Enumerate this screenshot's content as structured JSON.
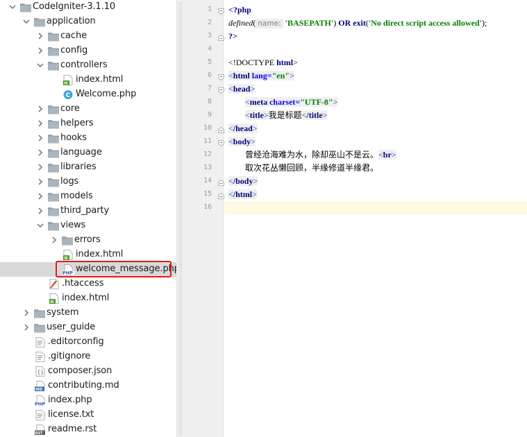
{
  "tree": {
    "items": [
      {
        "label": "CodeIgniter-3.1.10",
        "type": "folder",
        "state": "expanded"
      },
      {
        "label": "application",
        "type": "folder",
        "state": "expanded"
      },
      {
        "label": "cache",
        "type": "folder",
        "state": "collapsed"
      },
      {
        "label": "config",
        "type": "folder",
        "state": "collapsed"
      },
      {
        "label": "controllers",
        "type": "folder",
        "state": "expanded"
      },
      {
        "label": "index.html",
        "type": "html-file"
      },
      {
        "label": "Welcome.php",
        "type": "php-class-file"
      },
      {
        "label": "core",
        "type": "folder",
        "state": "collapsed"
      },
      {
        "label": "helpers",
        "type": "folder",
        "state": "collapsed"
      },
      {
        "label": "hooks",
        "type": "folder",
        "state": "collapsed"
      },
      {
        "label": "language",
        "type": "folder",
        "state": "collapsed"
      },
      {
        "label": "libraries",
        "type": "folder",
        "state": "collapsed"
      },
      {
        "label": "logs",
        "type": "folder",
        "state": "collapsed"
      },
      {
        "label": "models",
        "type": "folder",
        "state": "collapsed"
      },
      {
        "label": "third_party",
        "type": "folder",
        "state": "collapsed"
      },
      {
        "label": "views",
        "type": "folder",
        "state": "expanded"
      },
      {
        "label": "errors",
        "type": "folder",
        "state": "collapsed"
      },
      {
        "label": "index.html",
        "type": "html-file"
      },
      {
        "label": "welcome_message.php",
        "type": "php-file",
        "selected": true
      },
      {
        "label": ".htaccess",
        "type": "htaccess-file"
      },
      {
        "label": "index.html",
        "type": "html-file"
      },
      {
        "label": "system",
        "type": "folder",
        "state": "collapsed"
      },
      {
        "label": "user_guide",
        "type": "folder",
        "state": "collapsed"
      },
      {
        "label": ".editorconfig",
        "type": "text-file"
      },
      {
        "label": ".gitignore",
        "type": "text-file"
      },
      {
        "label": "composer.json",
        "type": "json-file"
      },
      {
        "label": "contributing.md",
        "type": "md-file"
      },
      {
        "label": "index.php",
        "type": "php-file"
      },
      {
        "label": "license.txt",
        "type": "text-file"
      },
      {
        "label": "readme.rst",
        "type": "rst-file"
      }
    ],
    "highlight_color": "#e21b1b"
  },
  "icons": {
    "php": "PHP",
    "html": "H",
    "md": "MD",
    "rst": "RST",
    "class": "C"
  },
  "editor": {
    "line_numbers": [
      "1",
      "2",
      "3",
      "4",
      "5",
      "6",
      "7",
      "8",
      "9",
      "10",
      "11",
      "12",
      "13",
      "14",
      "15",
      "16"
    ],
    "code": {
      "l1_open": "<?php",
      "l2_fn": "defined",
      "l2_paren_open": "(",
      "l2_hint": "name:",
      "l2_str1": "'BASEPATH'",
      "l2_mid": ") ",
      "l2_or": "OR",
      "l2_exit": " exit",
      "l2_paren2": "(",
      "l2_str2": "'No direct script access allowed'",
      "l2_end": ");",
      "l3_close": "?>",
      "l5_doctype_open": "<!DOCTYPE ",
      "l5_doctype_kw": "html",
      "l5_doctype_close": ">",
      "l6_lt": "<",
      "l6_tag": "html",
      "l6_attr": " lang=",
      "l6_val": "\"en\"",
      "l6_gt": ">",
      "l7": "head",
      "l8_tag": "meta",
      "l8_attr": " charset=",
      "l8_val": "\"UTF-8\"",
      "l9_tag": "title",
      "l9_text": "我是标题",
      "l9_close": "/title",
      "l10": "/head",
      "l11": "body",
      "l12_text": "曾经沧海难为水，除却巫山不是云。",
      "l12_br": "br",
      "l13_text": "取次花丛懒回顾，半缘修道半缘君。",
      "l14": "/body",
      "l15": "/html"
    }
  }
}
